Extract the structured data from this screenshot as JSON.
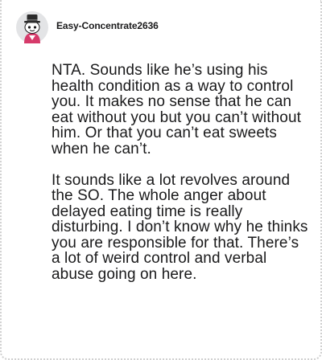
{
  "comment": {
    "author": {
      "username": "Easy-Concentrate2636",
      "avatar_icon": "snoo-avatar-icon",
      "avatar_colors": {
        "background": "#e3e4e6",
        "hat": "#2b2b2b",
        "body": "#d63a6a"
      }
    },
    "paragraphs": [
      "NTA. Sounds like he’s using his health condition as a way to control you. It makes no sense that he can eat without you but you can’t without him. Or that you can’t eat sweets when he can’t.",
      "It sounds like a lot revolves around the SO. The whole anger about delayed eating time is really disturbing. I don’t know why he thinks you are responsible for that. There’s a lot of weird control and verbal abuse going on here."
    ]
  }
}
